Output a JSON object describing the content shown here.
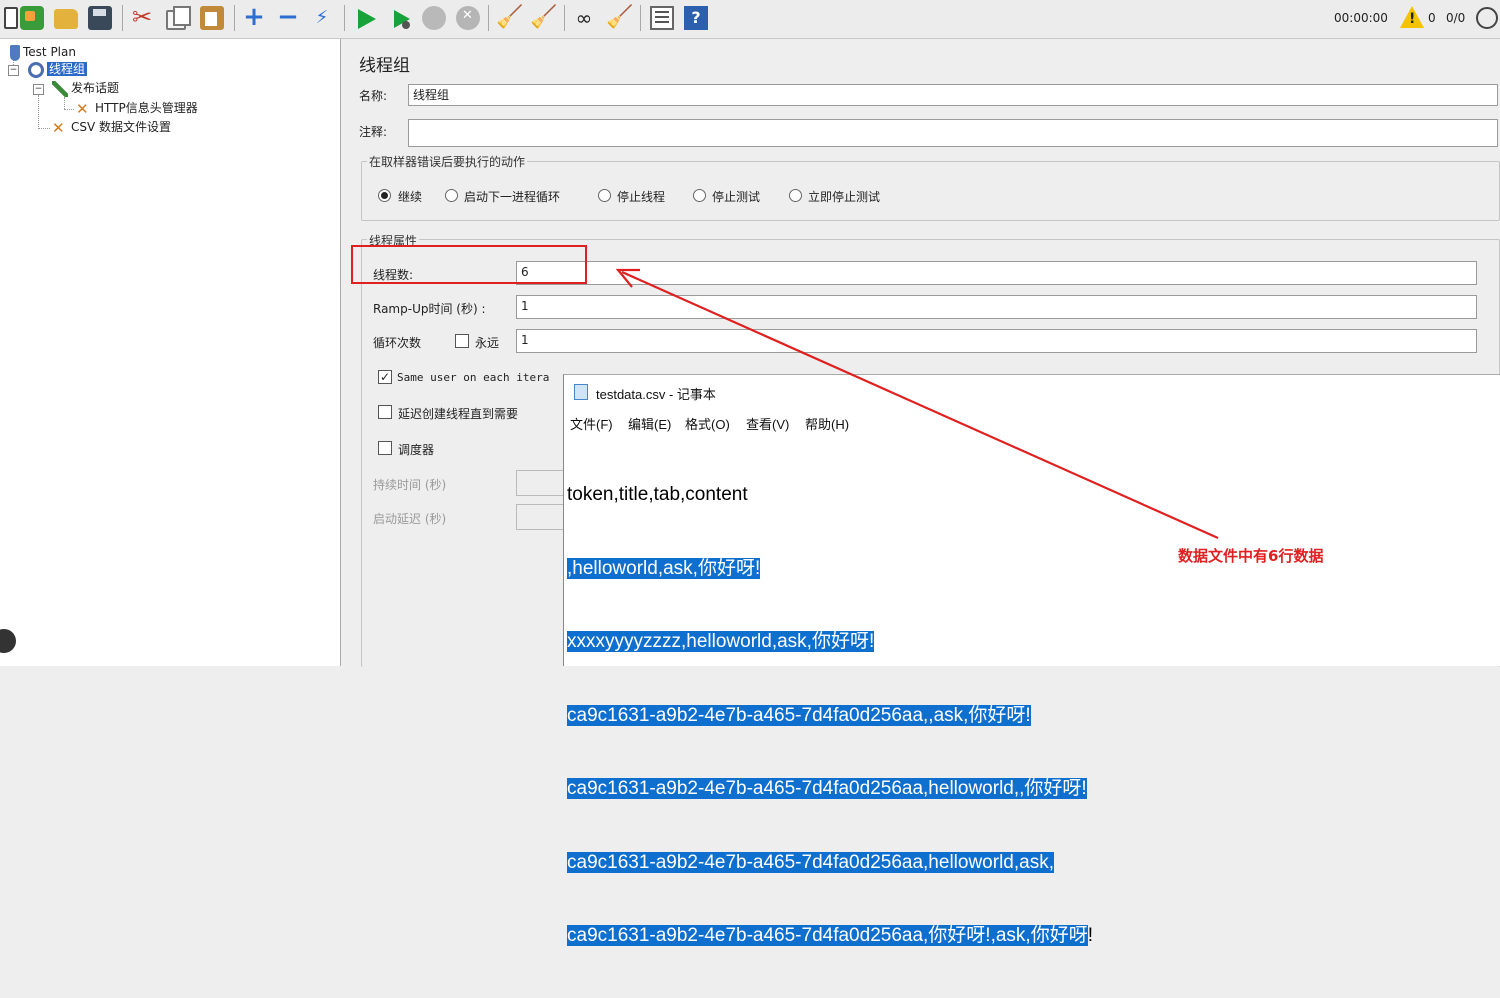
{
  "toolbar": {
    "icons": [
      "new-icon",
      "templates-icon",
      "open-icon",
      "save-icon",
      "cut-icon",
      "copy-icon",
      "paste-icon",
      "expand-icon",
      "collapse-icon",
      "toggle-icon",
      "start-icon",
      "start-no-pauses-icon",
      "stop-icon",
      "shutdown-icon",
      "clear-icon",
      "clear-all-icon",
      "search-icon",
      "reset-search-icon",
      "function-helper-icon",
      "help-icon"
    ],
    "timer": "00:00:00",
    "warnings": "0",
    "threads": "0/0"
  },
  "tree": {
    "nodes": [
      {
        "label": "Test Plan",
        "icon": "flask-icon"
      },
      {
        "label": "线程组",
        "icon": "gear-icon",
        "selected": true
      },
      {
        "label": "发布话题",
        "icon": "sampler-icon"
      },
      {
        "label": "HTTP信息头管理器",
        "icon": "wrench-icon"
      },
      {
        "label": "CSV 数据文件设置",
        "icon": "wrench-icon"
      }
    ]
  },
  "panel": {
    "title": "线程组",
    "name_label": "名称:",
    "name_value": "线程组",
    "comment_label": "注释:",
    "comment_value": "",
    "error_group_title": "在取样器错误后要执行的动作",
    "error_actions": [
      "继续",
      "启动下一进程循环",
      "停止线程",
      "停止测试",
      "立即停止测试"
    ],
    "selected_action": "继续",
    "props_group_title": "线程属性",
    "threads_label": "线程数:",
    "threads_value": "6",
    "rampup_label": "Ramp-Up时间 (秒) :",
    "rampup_value": "1",
    "loop_label": "循环次数",
    "forever_label": "永远",
    "loop_value": "1",
    "same_user_label": "Same user on each itera",
    "delay_label": "延迟创建线程直到需要",
    "scheduler_label": "调度器",
    "duration_label": "持续时间 (秒)",
    "startup_delay_label": "启动延迟 (秒)"
  },
  "notepad": {
    "title": "testdata.csv - 记事本",
    "menus": [
      "文件(F)",
      "编辑(E)",
      "格式(O)",
      "查看(V)",
      "帮助(H)"
    ],
    "lines": [
      {
        "text": "token,title,tab,content",
        "selected": false
      },
      {
        "text": ",helloworld,ask,你好呀!",
        "selected": true
      },
      {
        "text": "xxxxyyyyzzzz,helloworld,ask,你好呀!",
        "selected": true
      },
      {
        "text": "ca9c1631-a9b2-4e7b-a465-7d4fa0d256aa,,ask,你好呀!",
        "selected": true
      },
      {
        "text": "ca9c1631-a9b2-4e7b-a465-7d4fa0d256aa,helloworld,,你好呀!",
        "selected": true
      },
      {
        "text": "ca9c1631-a9b2-4e7b-a465-7d4fa0d256aa,helloworld,ask,",
        "selected": true
      },
      {
        "text": "ca9c1631-a9b2-4e7b-a465-7d4fa0d256aa,你好呀!,ask,你好呀",
        "selected": true,
        "tail": "!"
      }
    ]
  },
  "annotation": {
    "text": "数据文件中有6行数据",
    "color": "#e02020"
  }
}
